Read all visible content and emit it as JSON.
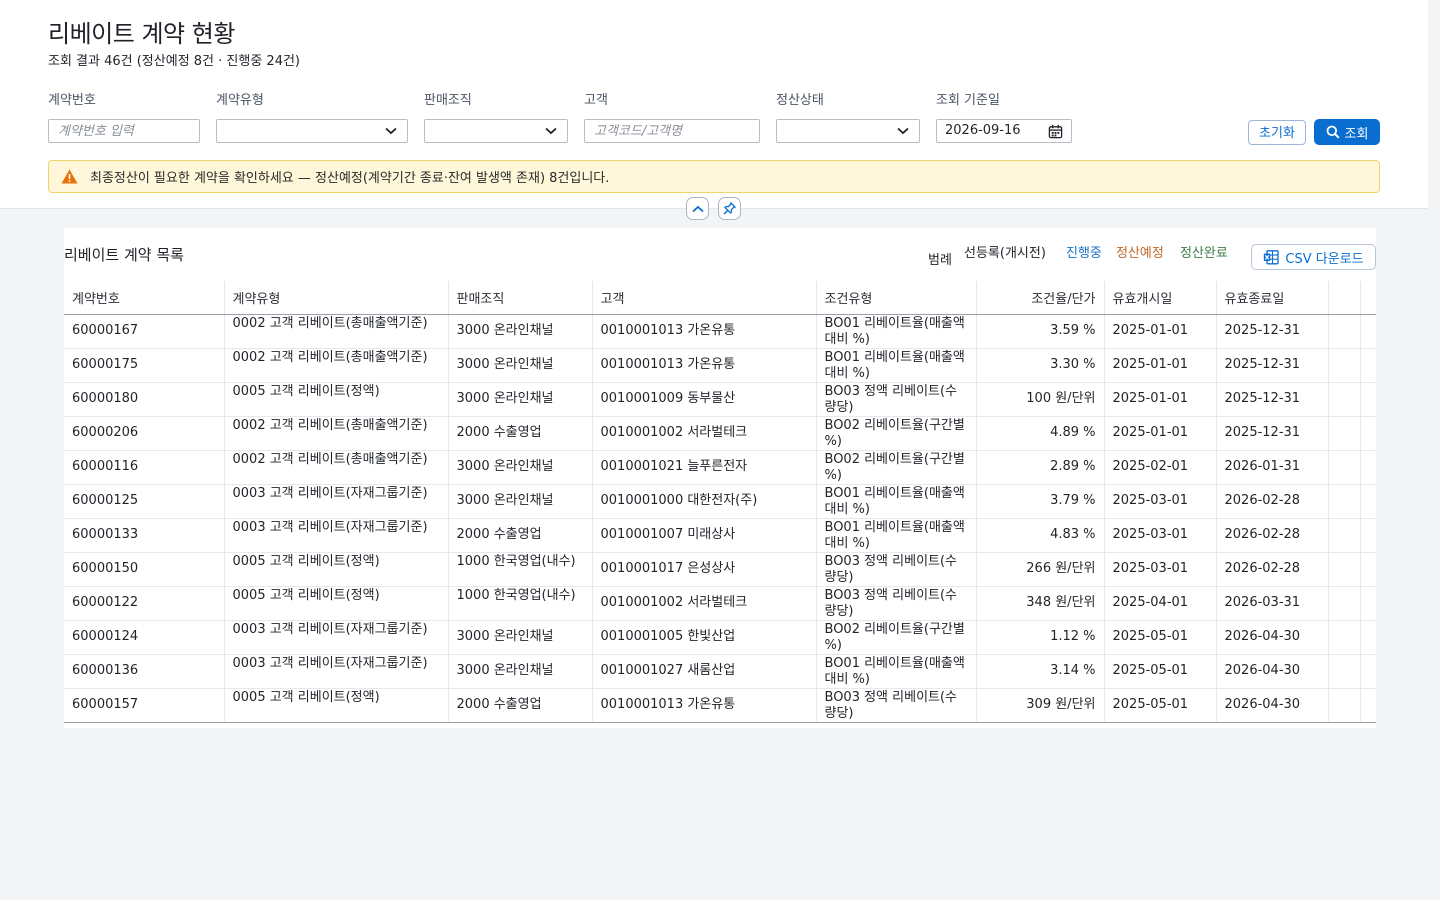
{
  "header": {
    "title": "리베이트 계약 현황",
    "subtitle": "조회 결과 46건 (정산예정 8건 · 진행중 24건)"
  },
  "filters": {
    "contract_no": {
      "label": "계약번호",
      "placeholder": "계약번호 입력",
      "value": ""
    },
    "contract_type": {
      "label": "계약유형",
      "value": ""
    },
    "sales_org": {
      "label": "판매조직",
      "value": ""
    },
    "customer": {
      "label": "고객",
      "placeholder": "고객코드/고객명",
      "value": ""
    },
    "settlement_status": {
      "label": "정산상태",
      "value": ""
    },
    "base_date": {
      "label": "조회 기준일",
      "value": "2026-09-16"
    }
  },
  "actions": {
    "reset_label": "초기화",
    "search_label": "조회"
  },
  "banner": {
    "text": "최종정산이 필요한 계약을 확인하세요 — 정산예정(계약기간 종료·잔여 발생액 존재) 8건입니다."
  },
  "list": {
    "title": "리베이트 계약 목록",
    "legend_label": "범례",
    "legend": [
      {
        "label": "선등록(개시전)",
        "color": "#1f2328"
      },
      {
        "label": "진행중",
        "color": "#1a73c8"
      },
      {
        "label": "정산예정",
        "color": "#c0692a"
      },
      {
        "label": "정산완료",
        "color": "#3a7d44"
      }
    ],
    "csv_label": "CSV 다운로드",
    "columns": [
      "계약번호",
      "계약유형",
      "판매조직",
      "고객",
      "조건유형",
      "조건율/단가",
      "유효개시일",
      "유효종료일"
    ],
    "rows": [
      {
        "no": "60000167",
        "type": "0002 고객 리베이트(총매출액기준)",
        "org": "3000 온라인채널",
        "customer": "0010001013 가온유통",
        "cond": "BO01 리베이트율(매출액대비 %)",
        "rate": "3.59 %",
        "start": "2025-01-01",
        "end": "2025-12-31"
      },
      {
        "no": "60000175",
        "type": "0002 고객 리베이트(총매출액기준)",
        "org": "3000 온라인채널",
        "customer": "0010001013 가온유통",
        "cond": "BO01 리베이트율(매출액대비 %)",
        "rate": "3.30 %",
        "start": "2025-01-01",
        "end": "2025-12-31"
      },
      {
        "no": "60000180",
        "type": "0005 고객 리베이트(정액)",
        "org": "3000 온라인채널",
        "customer": "0010001009 동부물산",
        "cond": "BO03 정액 리베이트(수량당)",
        "rate": "100 원/단위",
        "start": "2025-01-01",
        "end": "2025-12-31"
      },
      {
        "no": "60000206",
        "type": "0002 고객 리베이트(총매출액기준)",
        "org": "2000 수출영업",
        "customer": "0010001002 서라벌테크",
        "cond": "BO02 리베이트율(구간별 %)",
        "rate": "4.89 %",
        "start": "2025-01-01",
        "end": "2025-12-31"
      },
      {
        "no": "60000116",
        "type": "0002 고객 리베이트(총매출액기준)",
        "org": "3000 온라인채널",
        "customer": "0010001021 늘푸른전자",
        "cond": "BO02 리베이트율(구간별 %)",
        "rate": "2.89 %",
        "start": "2025-02-01",
        "end": "2026-01-31"
      },
      {
        "no": "60000125",
        "type": "0003 고객 리베이트(자재그룹기준)",
        "org": "3000 온라인채널",
        "customer": "0010001000 대한전자(주)",
        "cond": "BO01 리베이트율(매출액대비 %)",
        "rate": "3.79 %",
        "start": "2025-03-01",
        "end": "2026-02-28"
      },
      {
        "no": "60000133",
        "type": "0003 고객 리베이트(자재그룹기준)",
        "org": "2000 수출영업",
        "customer": "0010001007 미래상사",
        "cond": "BO01 리베이트율(매출액대비 %)",
        "rate": "4.83 %",
        "start": "2025-03-01",
        "end": "2026-02-28"
      },
      {
        "no": "60000150",
        "type": "0005 고객 리베이트(정액)",
        "org": "1000 한국영업(내수)",
        "customer": "0010001017 은성상사",
        "cond": "BO03 정액 리베이트(수량당)",
        "rate": "266 원/단위",
        "start": "2025-03-01",
        "end": "2026-02-28"
      },
      {
        "no": "60000122",
        "type": "0005 고객 리베이트(정액)",
        "org": "1000 한국영업(내수)",
        "customer": "0010001002 서라벌테크",
        "cond": "BO03 정액 리베이트(수량당)",
        "rate": "348 원/단위",
        "start": "2025-04-01",
        "end": "2026-03-31"
      },
      {
        "no": "60000124",
        "type": "0003 고객 리베이트(자재그룹기준)",
        "org": "3000 온라인채널",
        "customer": "0010001005 한빛산업",
        "cond": "BO02 리베이트율(구간별 %)",
        "rate": "1.12 %",
        "start": "2025-05-01",
        "end": "2026-04-30"
      },
      {
        "no": "60000136",
        "type": "0003 고객 리베이트(자재그룹기준)",
        "org": "3000 온라인채널",
        "customer": "0010001027 새롬산업",
        "cond": "BO01 리베이트율(매출액대비 %)",
        "rate": "3.14 %",
        "start": "2025-05-01",
        "end": "2026-04-30"
      },
      {
        "no": "60000157",
        "type": "0005 고객 리베이트(정액)",
        "org": "2000 수출영업",
        "customer": "0010001013 가온유통",
        "cond": "BO03 정액 리베이트(수량당)",
        "rate": "309 원/단위",
        "start": "2025-05-01",
        "end": "2026-04-30"
      }
    ]
  }
}
